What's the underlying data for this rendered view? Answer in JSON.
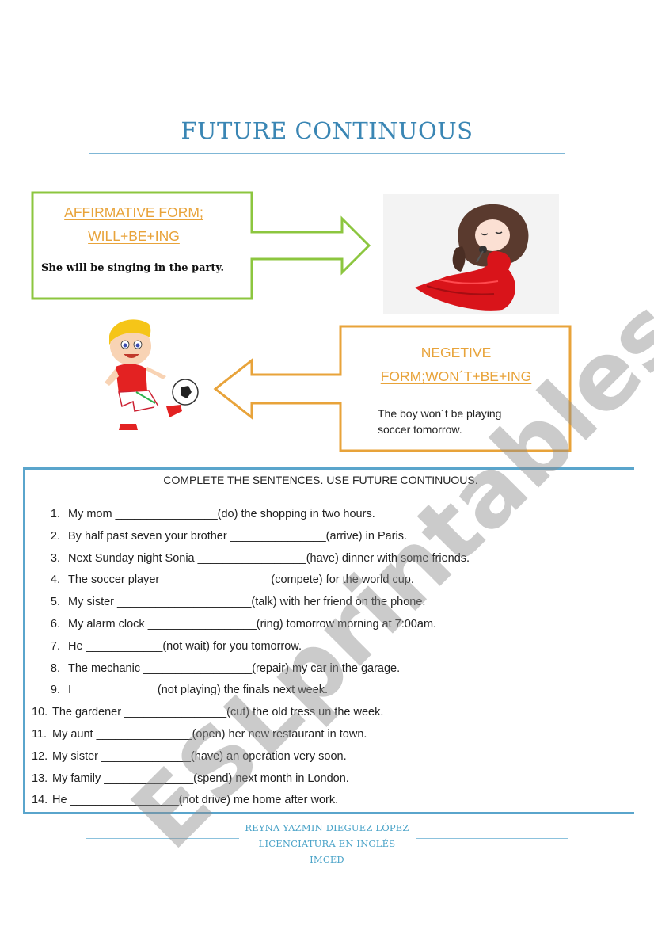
{
  "document": {
    "title": "FUTURE CONTINUOUS",
    "affirmative": {
      "heading_line1": "AFFIRMATIVE FORM;",
      "heading_line2": "WILL+BE+ING",
      "example": "She will be singing in the party.",
      "image": "girl-singing-red-dress"
    },
    "negative": {
      "heading_line1": "NEGETIVE",
      "heading_line2": "FORM;WON´T+BE+ING",
      "example_line1": "The boy won´t be playing",
      "example_line2": "soccer tomorrow.",
      "image": "boy-kicking-soccer-ball"
    },
    "exercise": {
      "instruction": "COMPLETE THE SENTENCES. USE FUTURE CONTINUOUS.",
      "items": [
        {
          "num": "1.",
          "text": "My mom ________________(do) the shopping in two hours."
        },
        {
          "num": "2.",
          "text": "By half past seven your brother _______________(arrive) in Paris."
        },
        {
          "num": "3.",
          "text": "Next Sunday night Sonia _________________(have) dinner with some friends."
        },
        {
          "num": "4.",
          "text": "The soccer player _________________(compete) for the world cup."
        },
        {
          "num": "5.",
          "text": "My sister _____________________(talk) with her friend on the phone."
        },
        {
          "num": "6.",
          "text": "My alarm clock _________________(ring) tomorrow morning at 7:00am."
        },
        {
          "num": "7.",
          "text": "He ____________(not wait) for you tomorrow."
        },
        {
          "num": "8.",
          "text": "The mechanic _________________(repair) my car in the garage."
        },
        {
          "num": "9.",
          "text": "I _____________(not playing) the finals next week."
        },
        {
          "num": "10.",
          "text": "The gardener ________________(cut) the old tress un the week."
        },
        {
          "num": "11.",
          "text": "My aunt _______________(open) her new restaurant in town."
        },
        {
          "num": "12.",
          "text": "My sister ______________(have) an operation very soon."
        },
        {
          "num": "13.",
          "text": "My family ______________(spend) next month in London."
        },
        {
          "num": "14.",
          "text": "He _________________(not drive) me home after work."
        }
      ]
    },
    "footer": {
      "line1": "REYNA YAZMIN DIEGUEZ LÓPEZ",
      "line2": "LICENCIATURA EN INGLÉS",
      "line3": "IMCED"
    },
    "watermark": "ESLprintables.com",
    "colors": {
      "title": "#3a86b4",
      "affirmative_border": "#8cc63f",
      "negative_border": "#e8a33a",
      "heading_text": "#e8a33a",
      "exercise_border": "#5aa5cc"
    }
  }
}
